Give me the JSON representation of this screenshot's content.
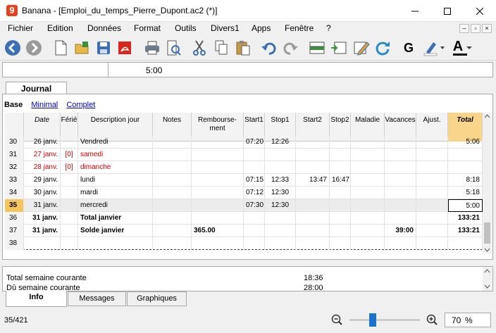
{
  "window": {
    "title": "Banana - [Emploi_du_temps_Pierre_Dupont.ac2 (*)]",
    "app_logo": "9"
  },
  "menu": [
    "Fichier",
    "Edition",
    "Données",
    "Format",
    "Outils",
    "Divers1",
    "Apps",
    "Fenêtre",
    "?"
  ],
  "toolbar_icons": [
    "back-icon",
    "forward-icon",
    "new-file-icon",
    "open-folder-icon",
    "save-icon",
    "pdf-icon",
    "print-icon",
    "print-preview-icon",
    "cut-icon",
    "copy-icon",
    "paste-icon",
    "undo-icon",
    "redo-icon",
    "add-row-icon",
    "insert-row-icon",
    "edit-icon",
    "refresh-icon",
    "bold-icon",
    "highlight-icon",
    "font-color-icon"
  ],
  "toolbar": {
    "bold": "G",
    "font_color": "A"
  },
  "formula_bar": {
    "cell_value": "5:00"
  },
  "tabs": {
    "journal": "Journal"
  },
  "views": {
    "base": "Base",
    "minimal": "Minimal",
    "complet": "Complet"
  },
  "columns": {
    "date": "Date",
    "ferie": "Férié",
    "description": "Description jour",
    "notes": "Notes",
    "remb1": "Rembourse-",
    "remb2": "ment",
    "start1": "Start1",
    "stop1": "Stop1",
    "start2": "Start2",
    "stop2": "Stop2",
    "maladie": "Maladie",
    "vacances": "Vacances",
    "ajust": "Ajust.",
    "total": "Total"
  },
  "rows": [
    {
      "n": "30",
      "date": "26 janv.",
      "ferie": "",
      "desc": "Vendredi",
      "start1": "07:20",
      "stop1": "12:26",
      "start2": "",
      "stop2": "",
      "remb": "",
      "vac": "",
      "total": "5:06"
    },
    {
      "n": "31",
      "date": "27 janv.",
      "ferie": "[0]",
      "desc": "samedi",
      "start1": "",
      "stop1": "",
      "start2": "",
      "stop2": "",
      "remb": "",
      "vac": "",
      "total": ""
    },
    {
      "n": "32",
      "date": "28 janv.",
      "ferie": "[0]",
      "desc": "dimanche",
      "start1": "",
      "stop1": "",
      "start2": "",
      "stop2": "",
      "remb": "",
      "vac": "",
      "total": ""
    },
    {
      "n": "33",
      "date": "29 janv.",
      "ferie": "",
      "desc": "lundi",
      "start1": "07:15",
      "stop1": "12:33",
      "start2": "13:47",
      "stop2": "16:47",
      "remb": "",
      "vac": "",
      "total": "8:18"
    },
    {
      "n": "34",
      "date": "30 janv.",
      "ferie": "",
      "desc": "mardi",
      "start1": "07:12",
      "stop1": "12:30",
      "start2": "",
      "stop2": "",
      "remb": "",
      "vac": "",
      "total": "5:18"
    },
    {
      "n": "35",
      "date": "31 janv.",
      "ferie": "",
      "desc": "mercredi",
      "start1": "07:30",
      "stop1": "12:30",
      "start2": "",
      "stop2": "",
      "remb": "",
      "vac": "",
      "total": "5:00"
    },
    {
      "n": "36",
      "date": "31 janv.",
      "ferie": "",
      "desc": "Total janvier",
      "start1": "",
      "stop1": "",
      "start2": "",
      "stop2": "",
      "remb": "",
      "vac": "",
      "total": "133:21"
    },
    {
      "n": "37",
      "date": "31 janv.",
      "ferie": "",
      "desc": "Solde janvier",
      "start1": "",
      "stop1": "",
      "start2": "",
      "stop2": "",
      "remb": "365.00",
      "vac": "39:00",
      "total": "133:21"
    },
    {
      "n": "38",
      "date": "",
      "ferie": "",
      "desc": "",
      "start1": "",
      "stop1": "",
      "start2": "",
      "stop2": "",
      "remb": "",
      "vac": "",
      "total": ""
    }
  ],
  "info": {
    "line1_label": "Total semaine courante",
    "line1_value": "18:36",
    "line2_label": "Dû semaine courante",
    "line2_value": "28:00"
  },
  "bottom_tabs": {
    "info": "Info",
    "messages": "Messages",
    "graphiques": "Graphiques"
  },
  "status": {
    "position": "35/421",
    "zoom": "70",
    "zoom_unit": "%",
    "zoom_fraction": 0.33
  },
  "colors": {
    "weekend_text": "#d00000",
    "total_header": "#f8d58a",
    "selected_rownum": "#f5c45a",
    "selected_row": "#ececec"
  }
}
